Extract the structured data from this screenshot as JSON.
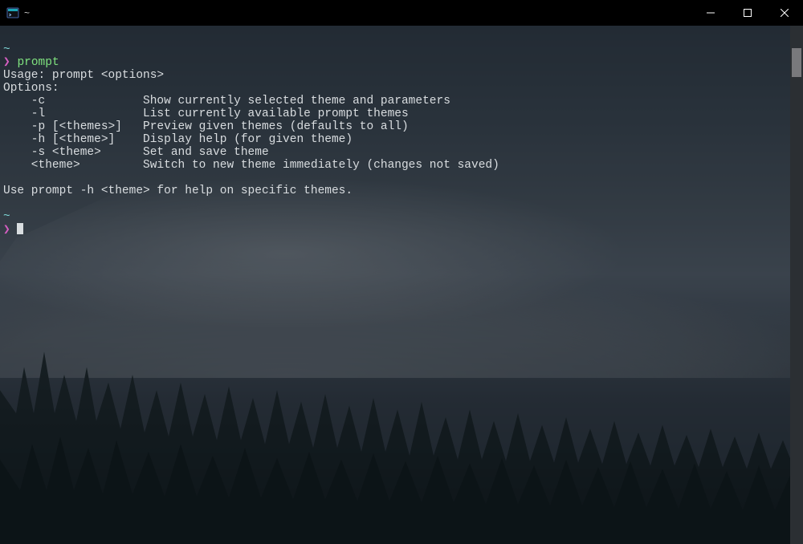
{
  "window": {
    "title": "~"
  },
  "colors": {
    "prompt_arrow": "#d65ec2",
    "prompt_tilde": "#7fd7d7",
    "command": "#7fe37f",
    "text": "#d9dde0"
  },
  "terminal": {
    "tilde_marker": "~",
    "prompt_arrow": "❯",
    "command": "prompt",
    "usage_line": "Usage: prompt <options>",
    "options_header": "Options:",
    "options": [
      {
        "flag": "-c",
        "pad": "              ",
        "desc": "Show currently selected theme and parameters"
      },
      {
        "flag": "-l",
        "pad": "              ",
        "desc": "List currently available prompt themes"
      },
      {
        "flag": "-p [<themes>]",
        "pad": "   ",
        "desc": "Preview given themes (defaults to all)"
      },
      {
        "flag": "-h [<theme>]",
        "pad": "    ",
        "desc": "Display help (for given theme)"
      },
      {
        "flag": "-s <theme>",
        "pad": "      ",
        "desc": "Set and save theme"
      },
      {
        "flag": "<theme>",
        "pad": "         ",
        "desc": "Switch to new theme immediately (changes not saved)"
      }
    ],
    "footer_line": "Use prompt -h <theme> for help on specific themes.",
    "indent": "    "
  }
}
